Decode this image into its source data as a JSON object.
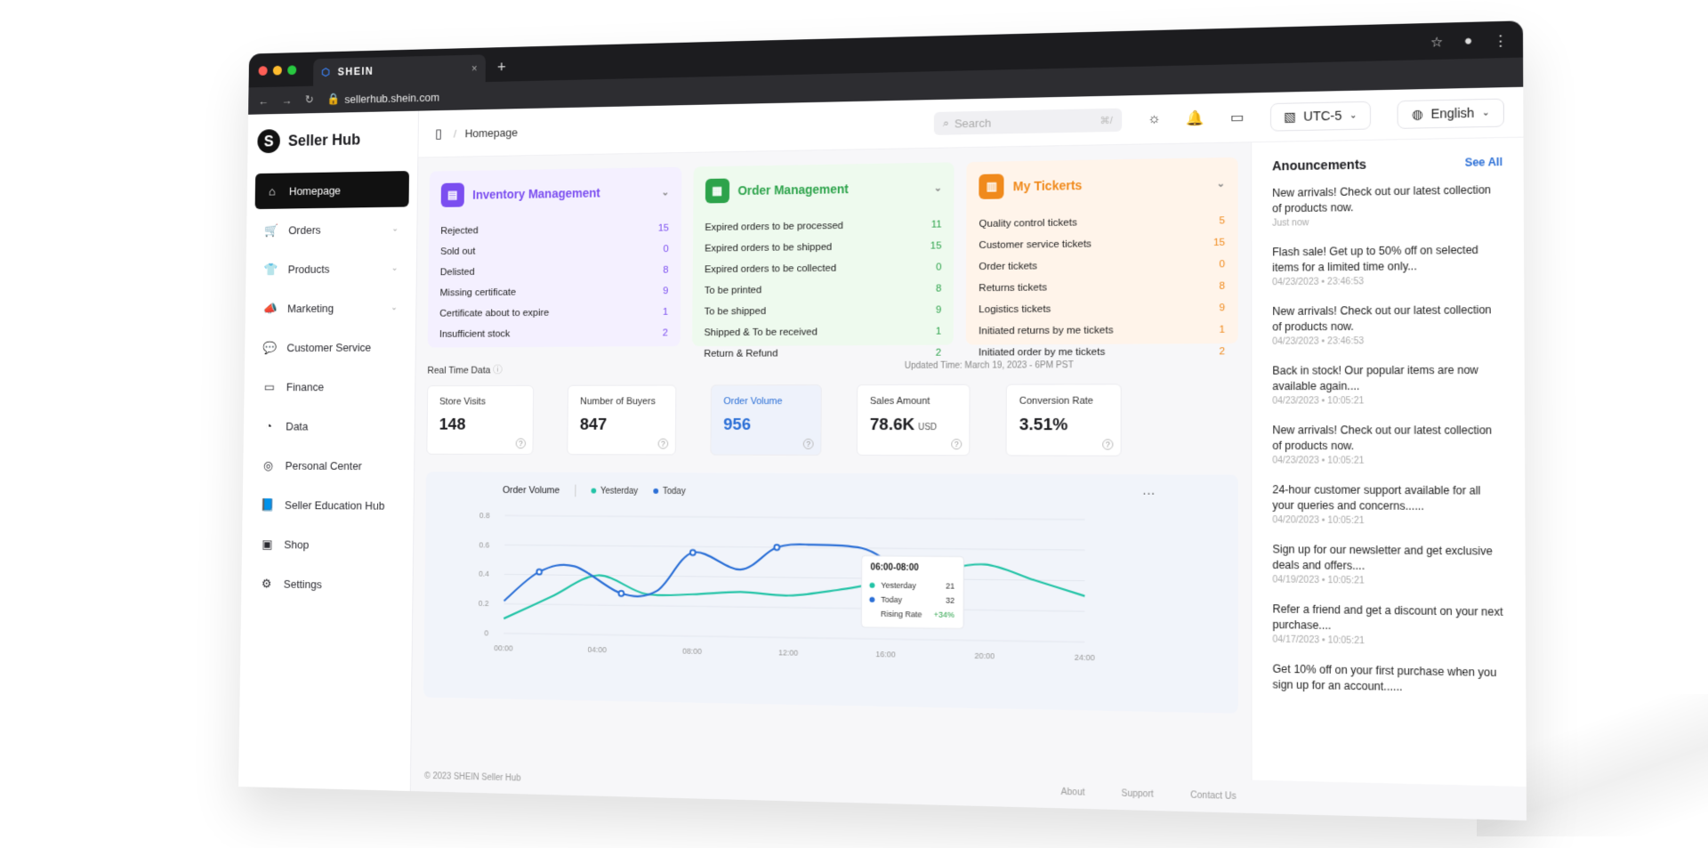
{
  "browser": {
    "tab_title": "SHEIN",
    "tab_close": "×",
    "new_tab": "+",
    "url": "sellerhub.shein.com",
    "traffic_lights": [
      "#ff5f57",
      "#febc2e",
      "#28c840"
    ]
  },
  "sidebar": {
    "brand": "Seller Hub",
    "brand_logo": "S",
    "items": [
      {
        "label": "Homepage",
        "icon": "home-icon",
        "glyph": "⌂",
        "active": true,
        "chevron": ""
      },
      {
        "label": "Orders",
        "icon": "cart-icon",
        "glyph": "🛒",
        "active": false,
        "chevron": "⌄"
      },
      {
        "label": "Products",
        "icon": "shirt-icon",
        "glyph": "👕",
        "active": false,
        "chevron": "⌄"
      },
      {
        "label": "Marketing",
        "icon": "megaphone-icon",
        "glyph": "📣",
        "active": false,
        "chevron": "⌄"
      },
      {
        "label": "Customer Service",
        "icon": "chat-icon",
        "glyph": "💬",
        "active": false,
        "chevron": ""
      },
      {
        "label": "Finance",
        "icon": "wallet-icon",
        "glyph": "▭",
        "active": false,
        "chevron": ""
      },
      {
        "label": "Data",
        "icon": "pie-chart-icon",
        "glyph": "◔",
        "active": false,
        "chevron": ""
      },
      {
        "label": "Personal Center",
        "icon": "user-circle-icon",
        "glyph": "◎",
        "active": false,
        "chevron": ""
      },
      {
        "label": "Seller Education Hub",
        "icon": "book-icon",
        "glyph": "📘",
        "active": false,
        "chevron": ""
      },
      {
        "label": "Shop",
        "icon": "store-icon",
        "glyph": "▣",
        "active": false,
        "chevron": ""
      },
      {
        "label": "Settings",
        "icon": "gear-icon",
        "glyph": "⚙",
        "active": false,
        "chevron": ""
      }
    ]
  },
  "topbar": {
    "breadcrumb_sep": "/",
    "breadcrumb": "Homepage",
    "search_placeholder": "Search",
    "search_shortcut": "⌘/",
    "timezone": "UTC-5",
    "language": "English"
  },
  "cards": [
    {
      "title": "Inventory Management",
      "theme": "purple",
      "accent": "#7b4ef0",
      "icon": "folder-icon",
      "glyph": "▤",
      "rows": [
        {
          "label": "Rejected",
          "value": "15"
        },
        {
          "label": "Sold out",
          "value": "0"
        },
        {
          "label": "Delisted",
          "value": "8"
        },
        {
          "label": "Missing certificate",
          "value": "9"
        },
        {
          "label": "Certificate about to expire",
          "value": "1"
        },
        {
          "label": "Insufficient stock",
          "value": "2"
        }
      ]
    },
    {
      "title": "Order Management",
      "theme": "green",
      "accent": "#2da34b",
      "icon": "clipboard-icon",
      "glyph": "▦",
      "rows": [
        {
          "label": "Expired orders to be processed",
          "value": "11"
        },
        {
          "label": "Expired orders to be shipped",
          "value": "15"
        },
        {
          "label": "Expired orders to be collected",
          "value": "0"
        },
        {
          "label": "To be printed",
          "value": "8"
        },
        {
          "label": "To be shipped",
          "value": "9"
        },
        {
          "label": "Shipped & To be received",
          "value": "1"
        },
        {
          "label": "Return & Refund",
          "value": "2"
        }
      ]
    },
    {
      "title": "My Tickerts",
      "theme": "orange",
      "accent": "#f08a1c",
      "icon": "ticket-icon",
      "glyph": "▥",
      "rows": [
        {
          "label": "Quality control tickets",
          "value": "5"
        },
        {
          "label": "Customer service tickets",
          "value": "15"
        },
        {
          "label": "Order tickets",
          "value": "0"
        },
        {
          "label": "Returns tickets",
          "value": "8"
        },
        {
          "label": "Logistics tickets",
          "value": "9"
        },
        {
          "label": "Initiated returns by me tickets",
          "value": "1"
        },
        {
          "label": "Initiated order by me tickets",
          "value": "2"
        }
      ]
    }
  ],
  "realtime": {
    "title": "Real Time Data",
    "updated": "Updated Time: March 19, 2023 - 6PM PST",
    "stats": [
      {
        "label": "Store Visits",
        "value": "148",
        "unit": "",
        "highlight": false
      },
      {
        "label": "Number of Buyers",
        "value": "847",
        "unit": "",
        "highlight": false
      },
      {
        "label": "Order Volume",
        "value": "956",
        "unit": "",
        "highlight": true
      },
      {
        "label": "Sales Amount",
        "value": "78.6K",
        "unit": "USD",
        "highlight": false
      },
      {
        "label": "Conversion Rate",
        "value": "3.51%",
        "unit": "",
        "highlight": false
      }
    ]
  },
  "chart_data": {
    "type": "line",
    "title": "Order Volume",
    "x_ticks": [
      "00:00",
      "04:00",
      "08:00",
      "12:00",
      "16:00",
      "20:00",
      "24:00"
    ],
    "y_ticks": [
      "0",
      "0.2",
      "0.4",
      "0.6",
      "0.8"
    ],
    "ylim": [
      0,
      0.8
    ],
    "xlim": [
      0,
      24
    ],
    "series": [
      {
        "name": "Yesterday",
        "color": "#22c3a6",
        "x": [
          0,
          2,
          4,
          6,
          8,
          10,
          12,
          14,
          16,
          18,
          20,
          22,
          24
        ],
        "values": [
          0.1,
          0.25,
          0.4,
          0.28,
          0.28,
          0.3,
          0.28,
          0.32,
          0.38,
          0.45,
          0.5,
          0.4,
          0.3
        ]
      },
      {
        "name": "Today",
        "color": "#2b6fd6",
        "x": [
          0,
          1.5,
          3,
          5,
          6.5,
          8,
          10,
          11.5,
          13,
          15,
          16
        ],
        "values": [
          0.22,
          0.42,
          0.46,
          0.28,
          0.3,
          0.56,
          0.45,
          0.6,
          0.62,
          0.6,
          0.52
        ]
      }
    ],
    "tooltip": {
      "range": "06:00-08:00",
      "rows": [
        {
          "label": "Yesterday",
          "value": "21",
          "color": "#22c3a6"
        },
        {
          "label": "Today",
          "value": "32",
          "color": "#2b6fd6"
        },
        {
          "label": "Rising Rate",
          "value": "+34%",
          "color": ""
        }
      ]
    },
    "more": "···"
  },
  "footer": {
    "copyright": "© 2023 SHEIN Seller Hub",
    "links": [
      "About",
      "Support",
      "Contact Us"
    ]
  },
  "announcements": {
    "title": "Anouncements",
    "see_all": "See All",
    "items": [
      {
        "msg": "New arrivals! Check out our latest collection of products now.",
        "time": "Just now"
      },
      {
        "msg": "Flash sale! Get up to 50% off on selected items for a limited time only...",
        "time": "04/23/2023 • 23:46:53"
      },
      {
        "msg": "New arrivals! Check out our latest collection of products now.",
        "time": "04/23/2023 • 23:46:53"
      },
      {
        "msg": "Back in stock! Our popular items are now available again....",
        "time": "04/23/2023 • 10:05:21"
      },
      {
        "msg": "New arrivals! Check out our latest collection of products now.",
        "time": "04/23/2023 • 10:05:21"
      },
      {
        "msg": "24-hour customer support available for all your queries and concerns......",
        "time": "04/20/2023 • 10:05:21"
      },
      {
        "msg": "Sign up for our newsletter and get exclusive deals and offers....",
        "time": "04/19/2023 • 10:05:21"
      },
      {
        "msg": "Refer a friend and get a discount on your next purchase....",
        "time": "04/17/2023 • 10:05:21"
      },
      {
        "msg": "Get 10% off on your first purchase when you sign up for an account......",
        "time": ""
      }
    ]
  }
}
